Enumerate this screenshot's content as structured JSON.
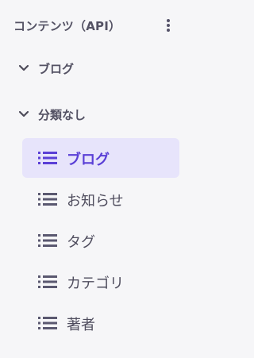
{
  "header": {
    "title": "コンテンツ（API）",
    "more_icon": "vertical-dots-icon"
  },
  "groups": [
    {
      "label": "ブログ",
      "icon": "chevron-down-icon"
    },
    {
      "label": "分類なし",
      "icon": "chevron-down-icon"
    }
  ],
  "items": [
    {
      "label": "ブログ",
      "icon": "list-icon",
      "active": true
    },
    {
      "label": "お知らせ",
      "icon": "list-icon",
      "active": false
    },
    {
      "label": "タグ",
      "icon": "list-icon",
      "active": false
    },
    {
      "label": "カテゴリ",
      "icon": "list-icon",
      "active": false
    },
    {
      "label": "著者",
      "icon": "list-icon",
      "active": false
    }
  ],
  "colors": {
    "accent": "#5a3fd6",
    "active_bg": "#e7e4fb",
    "text": "#545264"
  }
}
